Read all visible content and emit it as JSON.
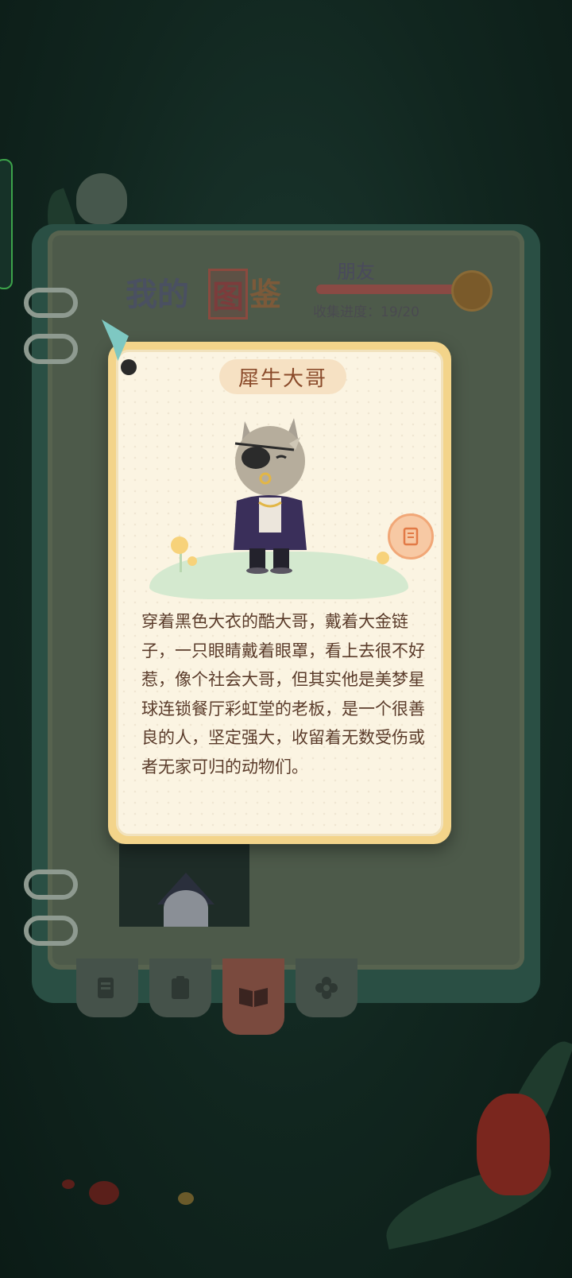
{
  "collection_page": {
    "title_part1": "我的",
    "title_part2": "图",
    "title_part3": "鉴",
    "category_label": "朋友",
    "progress_text": "收集进度：19/20",
    "progress": {
      "current": 19,
      "total": 20
    }
  },
  "bottom_tabs": [
    {
      "icon": "notes-icon",
      "active": false
    },
    {
      "icon": "clipboard-icon",
      "active": false
    },
    {
      "icon": "open-book-icon",
      "active": true
    },
    {
      "icon": "flower-icon",
      "active": false
    }
  ],
  "character_card": {
    "name": "犀牛大哥",
    "description": "穿着黑色大衣的酷大哥，戴着大金链子，一只眼睛戴着眼罩，看上去很不好惹，像个社会大哥，但其实他是美梦星球连锁餐厅彩虹堂的老板，是一个很善良的人，坚定强大，收留着无数受伤或者无家可归的动物们。"
  },
  "colors": {
    "background": "#11261f",
    "card_border": "#f3d48a",
    "card_fill": "#fbf4e2",
    "name_color": "#8a4a2a",
    "text_color": "#5a3b2a",
    "accent_orange": "#f1a777"
  }
}
